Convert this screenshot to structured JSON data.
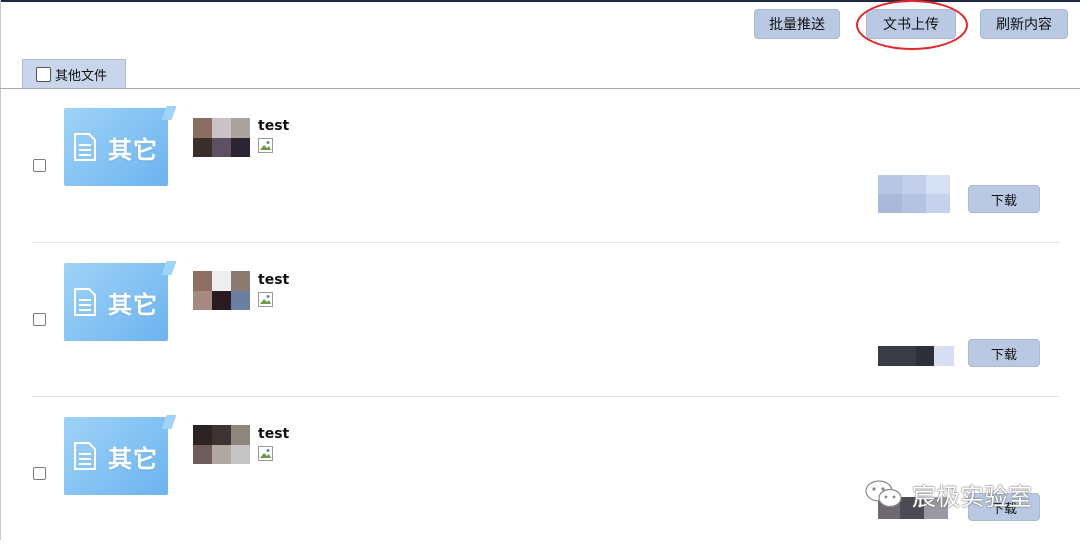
{
  "toolbar": {
    "batch_push_label": "批量推送",
    "upload_label": "文书上传",
    "refresh_label": "刷新内容"
  },
  "filter_tab": {
    "label": "其他文件",
    "checked": false
  },
  "files": [
    {
      "thumb_label": "其它",
      "user": "test",
      "download_label": "下载",
      "checked": false
    },
    {
      "thumb_label": "其它",
      "user": "test",
      "download_label": "下载",
      "checked": false
    },
    {
      "thumb_label": "其它",
      "user": "test",
      "download_label": "下载",
      "checked": false
    }
  ],
  "watermark": {
    "text": "宸极实验室"
  },
  "colors": {
    "button_bg": "#b9c9e3",
    "tab_bg": "#c8d5ea",
    "thumb_gradient_start": "#9fd3f7",
    "thumb_gradient_end": "#6cb3f0",
    "highlight_circle": "#e3262a"
  }
}
